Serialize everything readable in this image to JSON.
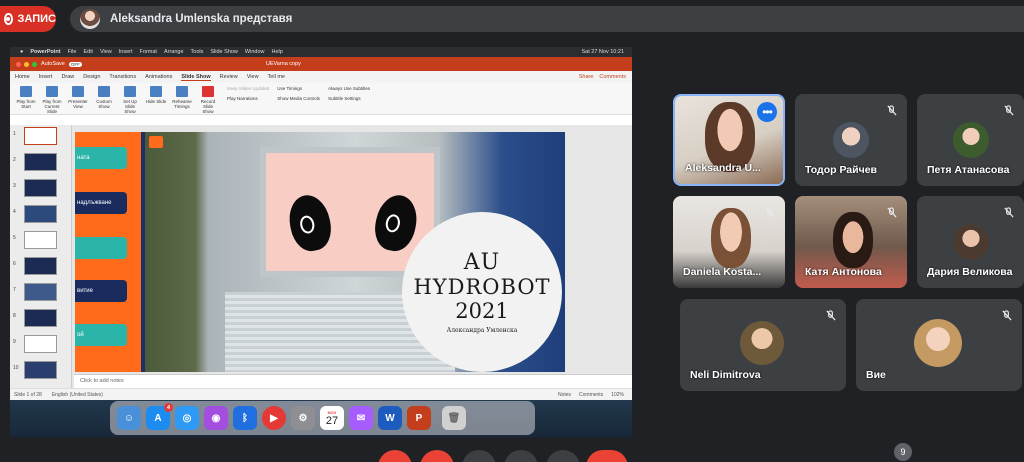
{
  "recording": {
    "label": "ЗАПИС"
  },
  "presenter": {
    "text": "Aleksandra Umlenska представя"
  },
  "mac_menu": {
    "app": "PowerPoint",
    "items": [
      "File",
      "Edit",
      "View",
      "Insert",
      "Format",
      "Arrange",
      "Tools",
      "Slide Show",
      "Window",
      "Help"
    ],
    "datetime": "Sat 27 Nov 10:21"
  },
  "ppt": {
    "autosave": "AutoSave",
    "autosave_state": "OFF",
    "doc_title": "UEVarna copy",
    "tabs": [
      "Home",
      "Insert",
      "Draw",
      "Design",
      "Transitions",
      "Animations",
      "Slide Show",
      "Review",
      "View",
      "Tell me"
    ],
    "active_tab": "Slide Show",
    "share": "Share",
    "comments": "Comments",
    "ribbon": [
      "Play from Start",
      "Play from Current Slide",
      "Presenter View",
      "Custom Show",
      "Set Up Slide Show",
      "Hide Slide",
      "Rehearse Timings",
      "Record Slide Show"
    ],
    "ribbon_options": {
      "keep_updated": "Keep Slides Updated",
      "play_narrations": "Play Narrations",
      "use_timings": "Use Timings",
      "show_media": "Show Media Controls",
      "always_subtitles": "Always Use Subtitles",
      "subtitle_settings": "Subtitle Settings"
    },
    "thumb_numbers": [
      "1",
      "2",
      "3",
      "4",
      "5",
      "6",
      "7",
      "8",
      "9",
      "10"
    ],
    "slide": {
      "btn_labels": [
        "ната",
        "надлъжване",
        "",
        "витие",
        "ой"
      ],
      "title_line1": "AU",
      "title_line2": "HYDROBOT",
      "title_line3": "2021",
      "author": "Александра Умленска"
    },
    "notes_placeholder": "Click to add notes",
    "status": {
      "slide_of": "Slide 1 of 28",
      "language": "English (United States)",
      "notes": "Notes",
      "comments": "Comments",
      "zoom": "102%"
    }
  },
  "dock": {
    "appstore_badge": "4",
    "calendar_month": "NOV",
    "calendar_day": "27"
  },
  "participants": [
    {
      "name": "Aleksandra U...",
      "active": true
    },
    {
      "name": "Тодор Райчев"
    },
    {
      "name": "Петя Атанасова"
    },
    {
      "name": "Daniela Kosta..."
    },
    {
      "name": "Катя Антонова"
    },
    {
      "name": "Дария Великова"
    },
    {
      "name": "Neli Dimitrova"
    },
    {
      "name": "Вие"
    }
  ],
  "people_count": "9",
  "colors": {
    "accent": "#8ab4f8",
    "record": "#d93025",
    "ppt": "#c43e1c",
    "tile": "#3c4043",
    "bg": "#202124"
  }
}
